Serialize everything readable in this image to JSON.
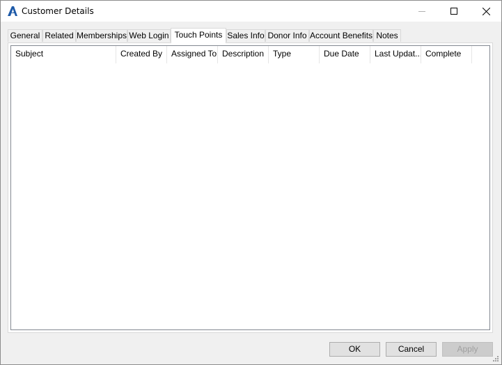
{
  "window": {
    "title": "Customer Details",
    "app_icon": "app-logo-icon",
    "controls": [
      "minimize-icon",
      "maximize-icon",
      "close-icon"
    ]
  },
  "tabs": [
    {
      "label": "General"
    },
    {
      "label": "Related"
    },
    {
      "label": "Memberships"
    },
    {
      "label": "Web Login"
    },
    {
      "label": "Touch Points",
      "active": true
    },
    {
      "label": "Sales Info"
    },
    {
      "label": "Donor Info"
    },
    {
      "label": "Account Benefits"
    },
    {
      "label": "Notes"
    }
  ],
  "list": {
    "columns": [
      "Subject",
      "Created By",
      "Assigned To",
      "Description",
      "Type",
      "Due Date",
      "Last Updat...",
      "Complete"
    ],
    "rows": []
  },
  "buttons": {
    "ok": "OK",
    "cancel": "Cancel",
    "apply": "Apply"
  },
  "colors": {
    "accent": "#1e5aa8"
  }
}
